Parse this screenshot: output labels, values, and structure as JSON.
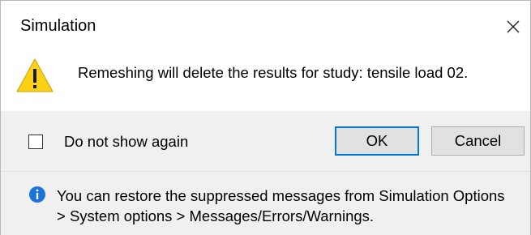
{
  "window": {
    "title": "Simulation",
    "close_icon": "close-icon"
  },
  "message": {
    "icon": "warning-icon",
    "text": "Remeshing will delete the results for study: tensile load 02."
  },
  "footer": {
    "checkbox_label": "Do not show again",
    "checkbox_checked": false,
    "ok_label": "OK",
    "cancel_label": "Cancel",
    "default_button_accent": "#0078d7"
  },
  "info": {
    "icon": "info-icon",
    "line1": "You can restore the suppressed messages from Simulation Options",
    "line2": "> System options > Messages/Errors/Warnings.",
    "icon_color": "#1a73d9"
  }
}
